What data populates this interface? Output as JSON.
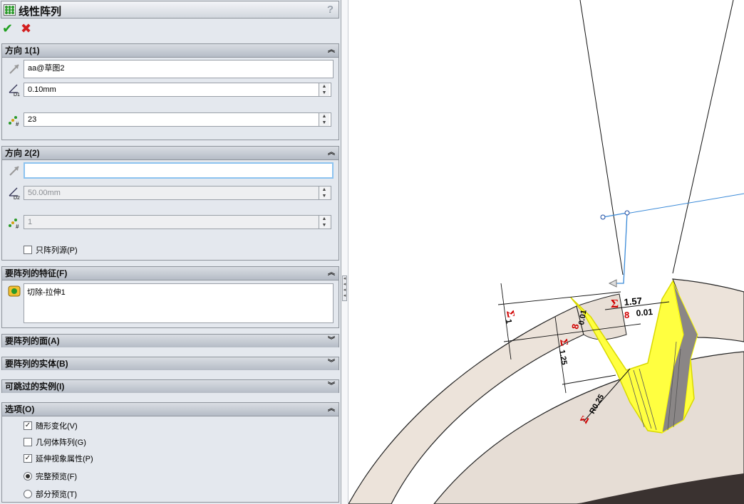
{
  "title": "线性阵列",
  "help": "?",
  "ok": "✔",
  "cancel": "✖",
  "dir1": {
    "header": "方向 1(1)",
    "edge_value": "aa@草图2",
    "spacing": "0.10mm",
    "count": "23"
  },
  "dir2": {
    "header": "方向 2(2)",
    "edge_value": "",
    "spacing": "50.00mm",
    "count": "1",
    "seed_only": "只阵列源(P)"
  },
  "features": {
    "header": "要阵列的特征(F)",
    "items": [
      "切除-拉伸1"
    ]
  },
  "faces": {
    "header": "要阵列的面(A)"
  },
  "bodies": {
    "header": "要阵列的实体(B)"
  },
  "skip": {
    "header": "可跳过的实例(I)"
  },
  "options": {
    "header": "选项(O)",
    "vary_sketch": "随形变化(V)",
    "geometry_pattern": "几何体阵列(G)",
    "propagate_visual": "延伸视象属性(P)",
    "full_preview": "完整预览(F)",
    "partial_preview": "部分预览(T)"
  },
  "annotations": {
    "dim1": "1.57",
    "dim2": "0.01",
    "dim3": "1.25",
    "dim4": "R0.25",
    "dim5": "1",
    "dim6": "0.01"
  },
  "colors": {
    "panel": "#e4e8ee",
    "header": "#b5bcc6",
    "highlight": "#ffff00",
    "dim_red": "#d00000",
    "sketch_blue": "#3a8ad8"
  }
}
